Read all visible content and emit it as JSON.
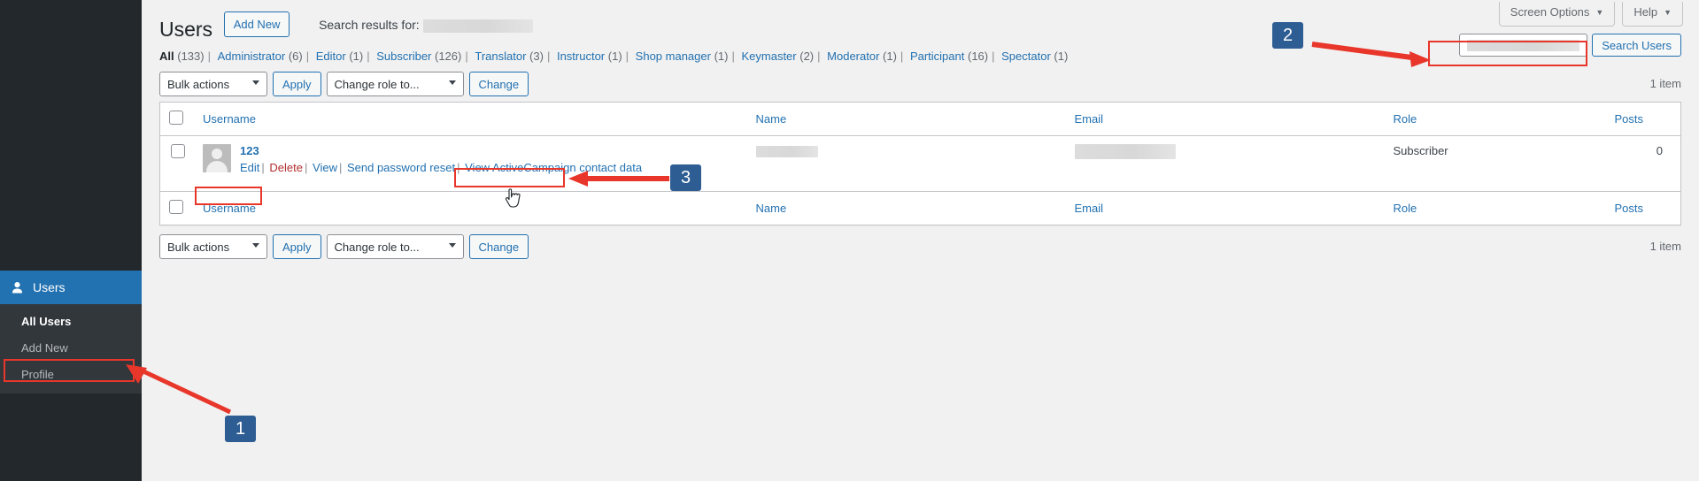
{
  "sidebar": {
    "active_menu": {
      "label": "Users",
      "icon": "user-icon"
    },
    "submenu": [
      {
        "label": "All Users",
        "current": true
      },
      {
        "label": "Add New",
        "current": false
      },
      {
        "label": "Profile",
        "current": false
      }
    ]
  },
  "screen_meta": {
    "screen_options_label": "Screen Options",
    "help_label": "Help",
    "caret": "▼"
  },
  "header": {
    "title": "Users",
    "add_new_label": "Add New",
    "search_results_label": "Search results for:",
    "search_results_value": ""
  },
  "search": {
    "value": "",
    "placeholder": "",
    "submit_label": "Search Users"
  },
  "filters": [
    {
      "label": "All",
      "count": "(133)",
      "current": true
    },
    {
      "label": "Administrator",
      "count": "(6)",
      "current": false
    },
    {
      "label": "Editor",
      "count": "(1)",
      "current": false
    },
    {
      "label": "Subscriber",
      "count": "(126)",
      "current": false
    },
    {
      "label": "Translator",
      "count": "(3)",
      "current": false
    },
    {
      "label": "Instructor",
      "count": "(1)",
      "current": false
    },
    {
      "label": "Shop manager",
      "count": "(1)",
      "current": false
    },
    {
      "label": "Keymaster",
      "count": "(2)",
      "current": false
    },
    {
      "label": "Moderator",
      "count": "(1)",
      "current": false
    },
    {
      "label": "Participant",
      "count": "(16)",
      "current": false
    },
    {
      "label": "Spectator",
      "count": "(1)",
      "current": false
    }
  ],
  "tablenav_top": {
    "bulk_actions_selected": "Bulk actions",
    "apply_label": "Apply",
    "change_role_selected": "Change role to...",
    "change_label": "Change",
    "displaying_num": "1 item"
  },
  "tablenav_bottom": {
    "bulk_actions_selected": "Bulk actions",
    "apply_label": "Apply",
    "change_role_selected": "Change role to...",
    "change_label": "Change",
    "displaying_num": "1 item"
  },
  "table": {
    "columns": {
      "username": "Username",
      "name": "Name",
      "email": "Email",
      "role": "Role",
      "posts": "Posts"
    },
    "rows": [
      {
        "username": "123",
        "name": "",
        "email": "",
        "role": "Subscriber",
        "posts": "0",
        "actions": {
          "edit": "Edit",
          "delete": "Delete",
          "view": "View",
          "send_password_reset": "Send password reset",
          "view_activecampaign": "View ActiveCampaign contact data"
        }
      }
    ]
  },
  "annotations": [
    {
      "id": "1",
      "label": "1"
    },
    {
      "id": "2",
      "label": "2"
    },
    {
      "id": "3",
      "label": "3"
    }
  ],
  "colors": {
    "wp_blue": "#2271b1",
    "sidebar": "#23282d",
    "submenu": "#32373c",
    "annotation_red": "#e8362a",
    "annotation_badge": "#2e5d94"
  }
}
